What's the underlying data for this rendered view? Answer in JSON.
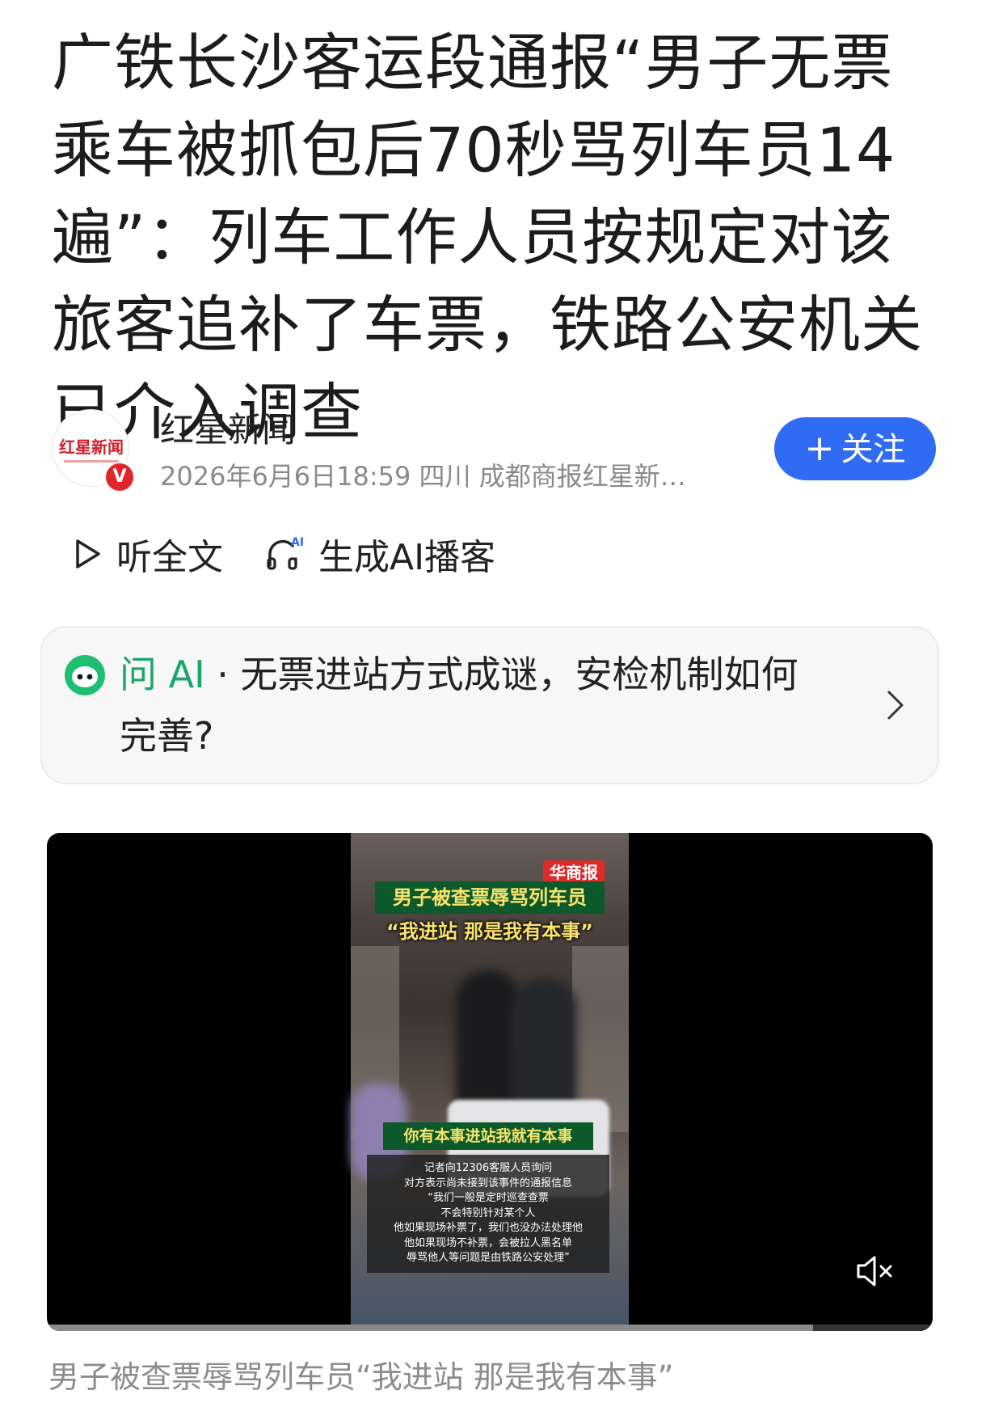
{
  "article": {
    "headline": "广铁长沙客运段通报“男子无票乘车被抓包后70秒骂列车员14遍”：列车工作人员按规定对该旅客追补了车票，铁路公安机关已介入调查"
  },
  "author": {
    "avatar_text": "红星新闻",
    "verified_badge": "V",
    "name": "红星新闻",
    "meta": "2026年6月6日18:59 四川 成都商报红星新…",
    "follow_label": "关注",
    "follow_plus": "+"
  },
  "actions": {
    "listen_label": "听全文",
    "podcast_label": "生成AI播客",
    "podcast_badge": "AI"
  },
  "ask_ai": {
    "label": "问 AI",
    "separator": " · ",
    "question": "无票进站方式成谜，安检机制如何完善?"
  },
  "video": {
    "logo": "华商报",
    "title_line1": "男子被查票辱骂列车员",
    "title_line2": "“我进站 那是我有本事”",
    "subtitle": "你有本事进站我就有本事",
    "notice_lines": [
      "记者向12306客服人员询问",
      "对方表示尚未接到该事件的通报信息",
      "“我们一般是定时巡查查票",
      "不会特别针对某个人",
      "他如果现场补票了，我们也没办法处理他",
      "他如果现场不补票，会被拉人黑名单",
      "辱骂他人等问题是由铁路公安处理”"
    ],
    "progress": 0.865,
    "muted": true,
    "caption": "男子被查票辱骂列车员“我进站 那是我有本事”"
  },
  "colors": {
    "follow_button": "#2f6cf3",
    "ai_green": "#1aa56b",
    "video_title_bg": "#0c5a2b",
    "video_title_text": "#fbe36a"
  }
}
